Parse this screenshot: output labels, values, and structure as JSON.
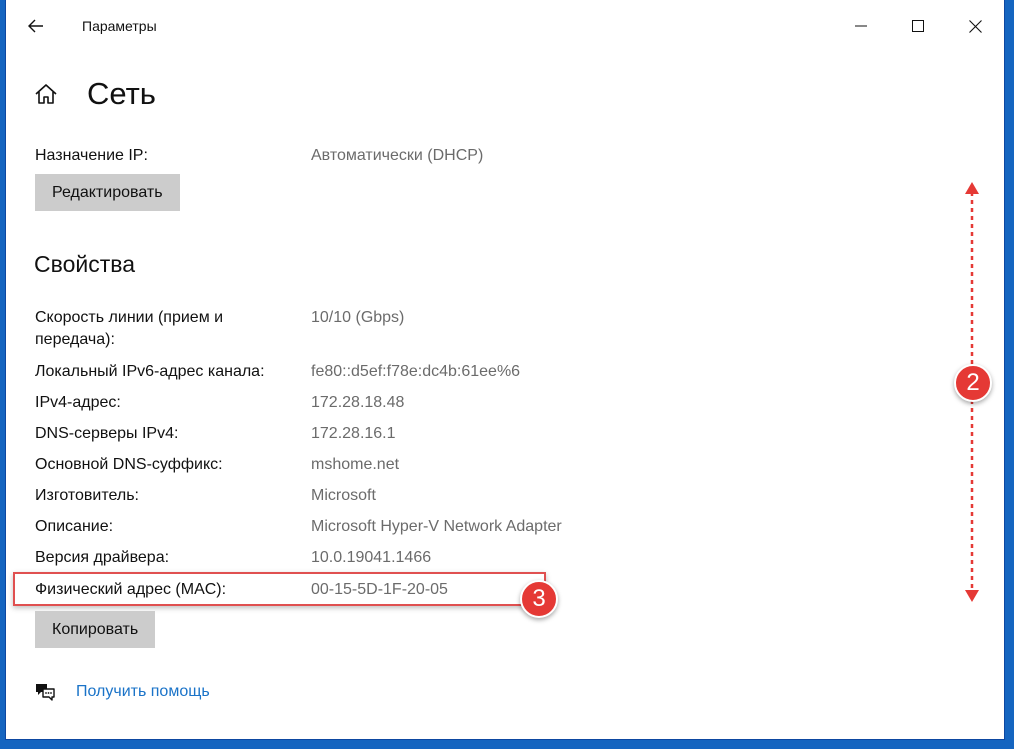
{
  "window": {
    "title": "Параметры",
    "back_icon": "back-arrow-icon",
    "controls": [
      "minimize-icon",
      "maximize-icon",
      "close-icon"
    ]
  },
  "page": {
    "title": "Сеть",
    "home_icon": "home-icon"
  },
  "ip_assignment": {
    "label": "Назначение IP:",
    "value": "Автоматически (DHCP)",
    "edit_button": "Редактировать"
  },
  "properties": {
    "title": "Свойства",
    "rows": [
      {
        "label": "Скорость линии (прием и передача):",
        "value": "10/10 (Gbps)"
      },
      {
        "label": "Локальный IPv6-адрес канала:",
        "value": "fe80::d5ef:f78e:dc4b:61ee%6"
      },
      {
        "label": "IPv4-адрес:",
        "value": "172.28.18.48"
      },
      {
        "label": "DNS-серверы IPv4:",
        "value": "172.28.16.1"
      },
      {
        "label": "Основной DNS-суффикс:",
        "value": "mshome.net"
      },
      {
        "label": "Изготовитель:",
        "value": "Microsoft"
      },
      {
        "label": "Описание:",
        "value": "Microsoft Hyper-V Network Adapter"
      },
      {
        "label": "Версия драйвера:",
        "value": "10.0.19041.1466"
      },
      {
        "label": "Физический адрес (MAC):",
        "value": "00-15-5D-1F-20-05"
      }
    ],
    "copy_button": "Копировать"
  },
  "annotations": {
    "badge_scroll": "2",
    "badge_mac": "3",
    "accent_color": "#e53935"
  },
  "help": {
    "icon": "help-chat-icon",
    "link": "Получить помощь"
  }
}
